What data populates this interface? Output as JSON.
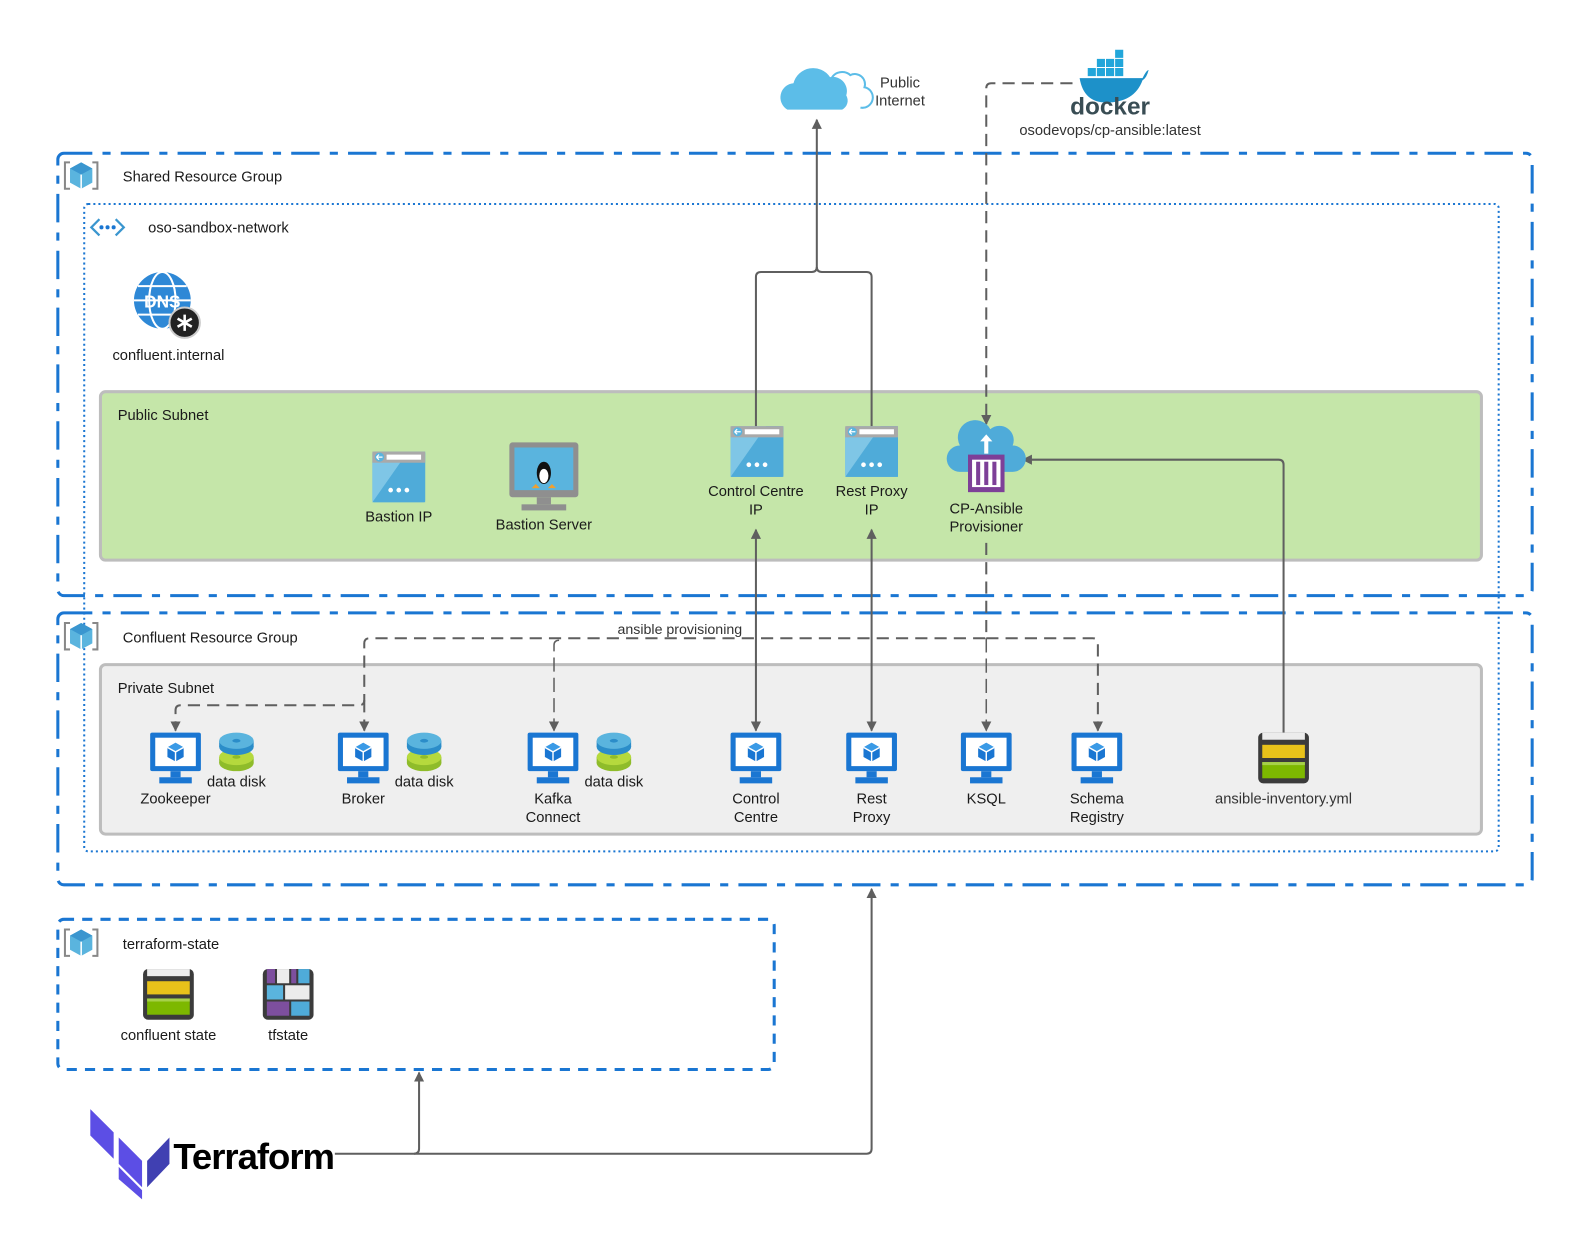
{
  "colors": {
    "azure_blue": "#1a76d2",
    "public_subnet": "#c5e6a9",
    "private_subnet": "#efefef",
    "terraform_purple": "#5c4ee5",
    "line": "#5f5f5f"
  },
  "external": {
    "internet_label_1": "Public",
    "internet_label_2": "Internet",
    "docker_wordmark": "docker",
    "docker_image": "osodevops/cp-ansible:latest"
  },
  "shared_rg": {
    "title": "Shared Resource Group",
    "network": {
      "title": "oso-sandbox-network",
      "dns_label": "confluent.internal",
      "dns_icon_text": "DNS"
    },
    "public_subnet": {
      "title": "Public Subnet",
      "items": [
        {
          "label_1": "Bastion IP",
          "icon": "public-ip-icon"
        },
        {
          "label_1": "Bastion Server",
          "icon": "linux-vm-icon"
        },
        {
          "label_1": "Control Centre",
          "label_2": "IP",
          "icon": "public-ip-icon"
        },
        {
          "label_1": "Rest Proxy",
          "label_2": "IP",
          "icon": "public-ip-icon"
        },
        {
          "label_1": "CP-Ansible",
          "label_2": "Provisioner",
          "icon": "container-instance-icon"
        }
      ]
    }
  },
  "confluent_rg": {
    "title": "Confluent Resource Group",
    "edge_label": "ansible provisioning",
    "private_subnet": {
      "title": "Private Subnet",
      "vms": [
        {
          "label_1": "Zookeeper",
          "disk": "data disk"
        },
        {
          "label_1": "Broker",
          "disk": "data disk"
        },
        {
          "label_1": "Kafka",
          "label_2": "Connect",
          "disk": "data disk"
        },
        {
          "label_1": "Control",
          "label_2": "Centre"
        },
        {
          "label_1": "Rest",
          "label_2": "Proxy"
        },
        {
          "label_1": "KSQL"
        },
        {
          "label_1": "Schema",
          "label_2": "Registry"
        }
      ],
      "inventory": "ansible-inventory.yml"
    }
  },
  "terraform_state": {
    "title": "terraform-state",
    "items": [
      "confluent state",
      "tfstate"
    ]
  },
  "terraform": {
    "wordmark": "Terraform"
  }
}
